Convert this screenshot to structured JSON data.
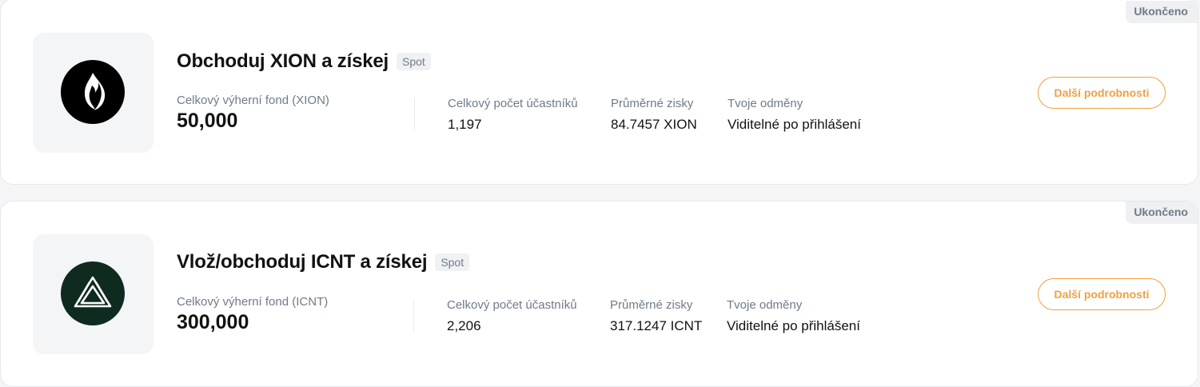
{
  "campaigns": [
    {
      "status": "Ukončeno",
      "title": "Obchoduj XION a získej",
      "tag": "Spot",
      "pool_label": "Celkový výherní fond (XION)",
      "pool_value": "50,000",
      "participants_label": "Celkový počet účastníků",
      "participants_value": "1,197",
      "avg_label": "Průměrné zisky",
      "avg_value": "84.7457 XION",
      "rewards_label": "Tvoje odměny",
      "rewards_value": "Viditelné po přihlášení",
      "button_label": "Další podrobnosti",
      "logo_icon": "xion-flame-icon",
      "logo_color": "#000000"
    },
    {
      "status": "Ukončeno",
      "title": "Vlož/obchoduj ICNT a získej",
      "tag": "Spot",
      "pool_label": "Celkový výherní fond (ICNT)",
      "pool_value": "300,000",
      "participants_label": "Celkový počet účastníků",
      "participants_value": "2,206",
      "avg_label": "Průměrné zisky",
      "avg_value": "317.1247 ICNT",
      "rewards_label": "Tvoje odměny",
      "rewards_value": "Viditelné po přihlášení",
      "button_label": "Další podrobnosti",
      "logo_icon": "icnt-triangle-icon",
      "logo_color": "#0f2a1f"
    }
  ],
  "colors": {
    "accent": "#f0a040",
    "muted_text": "#707a8a",
    "text": "#121212"
  }
}
